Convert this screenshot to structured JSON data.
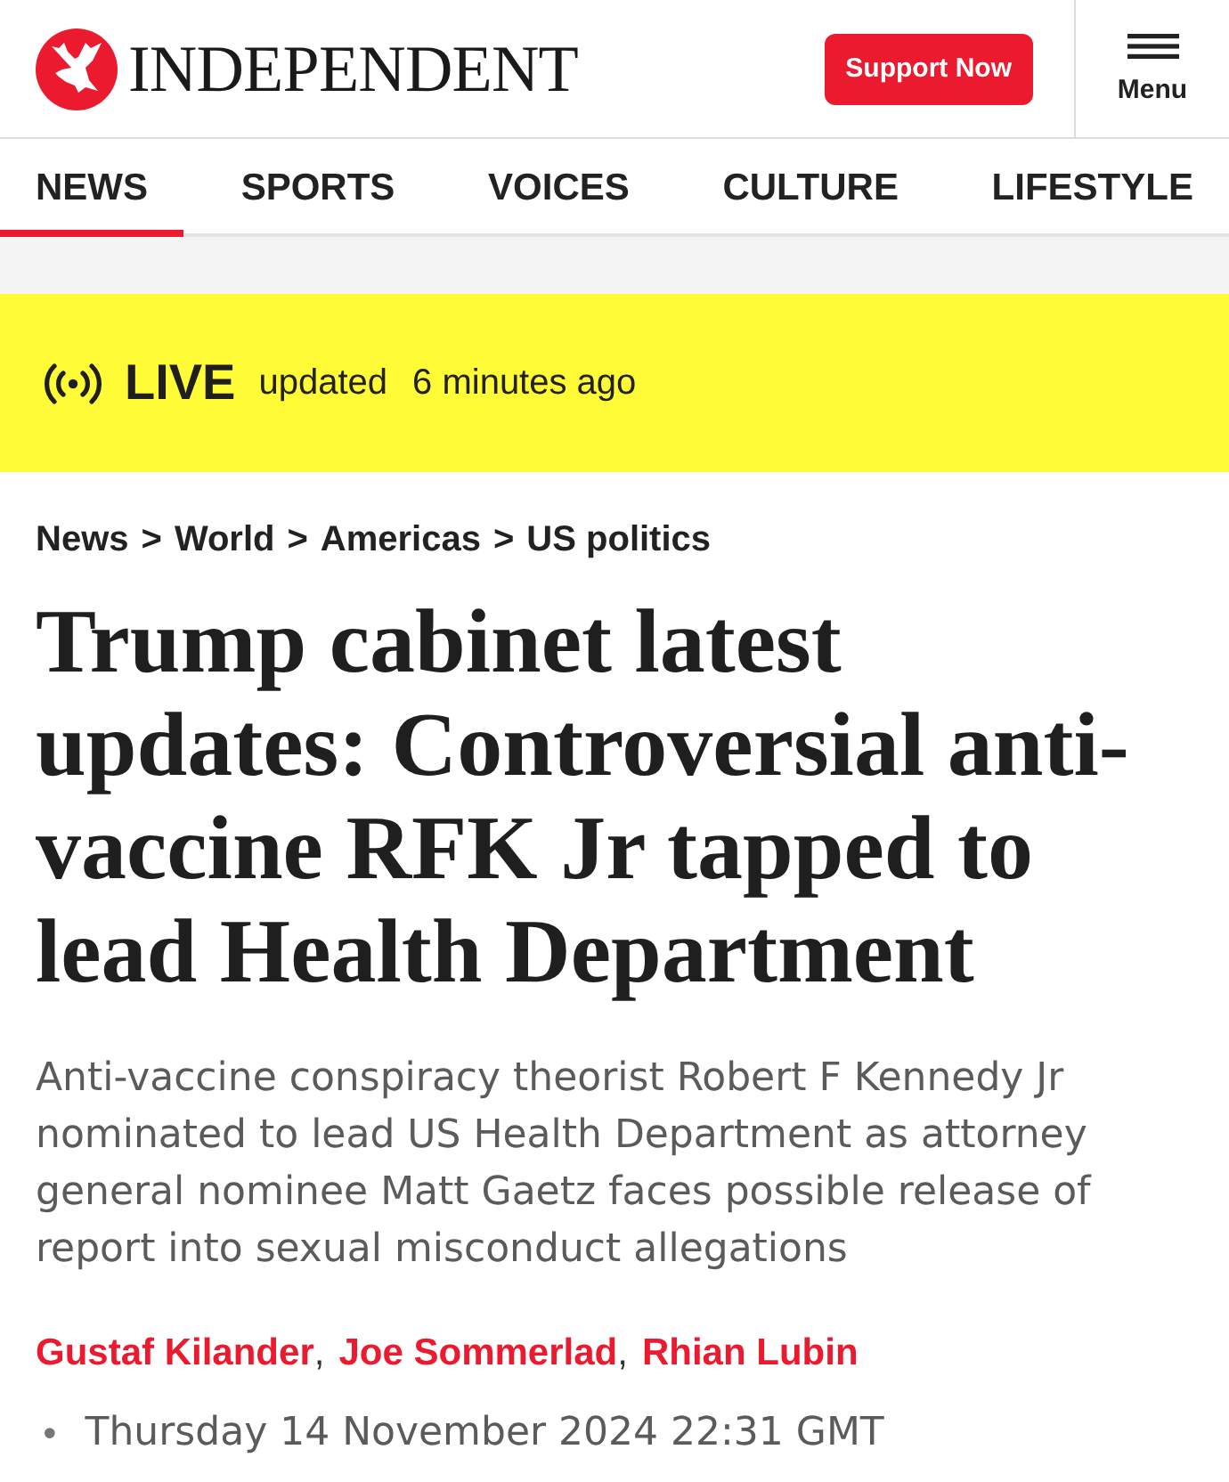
{
  "header": {
    "logo_text": "INDEPENDENT",
    "support_button": "Support Now",
    "menu_label": "Menu"
  },
  "nav": {
    "items": [
      {
        "label": "NEWS",
        "selected": true
      },
      {
        "label": "SPORTS",
        "selected": false
      },
      {
        "label": "VOICES",
        "selected": false
      },
      {
        "label": "CULTURE",
        "selected": false
      },
      {
        "label": "LIFESTYLE",
        "selected": false
      }
    ]
  },
  "live_banner": {
    "label": "LIVE",
    "updated_label": "updated",
    "updated_time": "6 minutes ago"
  },
  "breadcrumb": {
    "items": [
      {
        "label": "News",
        "separator": ">"
      },
      {
        "label": "World",
        "separator": ">"
      },
      {
        "label": "Americas",
        "separator": ">"
      },
      {
        "label": "US politics"
      }
    ]
  },
  "headline": "Trump cabinet latest updates: Controversial anti-vaccine RFK Jr tapped to lead Health Department",
  "standfirst": "Anti-vaccine conspiracy theorist Robert F Kennedy Jr nominated to lead US Health Department as attorney general nominee Matt Gaetz faces possible release of report into sexual misconduct allegations",
  "authors": [
    {
      "name": "Gustaf Kilander",
      "separator": ","
    },
    {
      "name": "Joe Sommerlad",
      "separator": ","
    },
    {
      "name": "Rhian Lubin"
    }
  ],
  "date": {
    "bullet": "•",
    "text": "Thursday 14 November 2024 22:31 GMT"
  }
}
